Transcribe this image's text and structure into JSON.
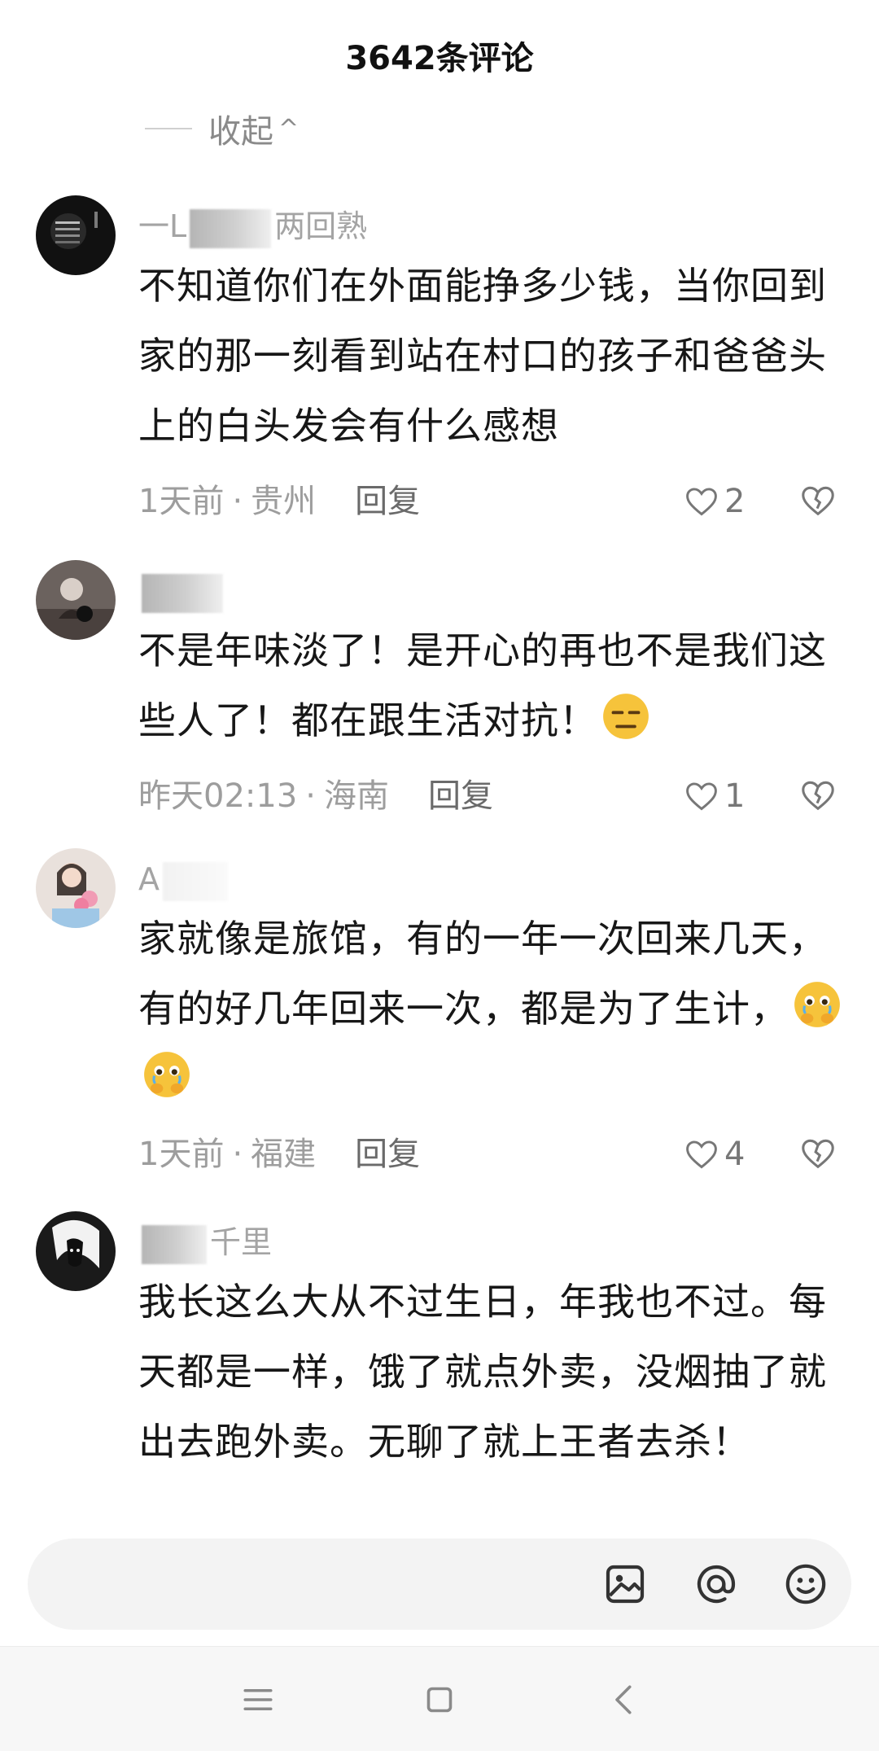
{
  "header": {
    "title": "3642条评论"
  },
  "collapse": {
    "label": "收起"
  },
  "comments": [
    {
      "username_prefix": "一L",
      "username_suffix": "两回熟",
      "text": "不知道你们在外面能挣多少钱，当你回到家的那一刻看到站在村口的孩子和爸爸头上的白头发会有什么感想",
      "time": "1天前",
      "location": "贵州",
      "reply": "回复",
      "likes": "2",
      "emojis": []
    },
    {
      "username_prefix": "",
      "username_suffix": "",
      "text": "不是年味淡了！是开心的再也不是我们这些人了！都在跟生活对抗！",
      "time": "昨天02:13",
      "location": "海南",
      "reply": "回复",
      "likes": "1",
      "emojis": [
        "unamused-face-emoji"
      ]
    },
    {
      "username_prefix": "A",
      "username_suffix": "",
      "text": "家就像是旅馆，有的一年一次回来几天，有的好几年回来一次，都是为了生计，",
      "time": "1天前",
      "location": "福建",
      "reply": "回复",
      "likes": "4",
      "emojis": [
        "holding-back-tears-emoji",
        "holding-back-tears-emoji"
      ]
    },
    {
      "username_prefix": "",
      "username_suffix": "千里",
      "text": "我长这么大从不过生日，年我也不过。每天都是一样，饿了就点外卖，没烟抽了就出去跑外卖。无聊了就上王者去杀！",
      "time": "",
      "location": "",
      "reply": "",
      "likes": "",
      "emojis": []
    }
  ],
  "meta_separator": "·",
  "input_bar": {
    "placeholder": "",
    "icons": [
      "image-icon",
      "at-icon",
      "emoji-icon"
    ]
  },
  "nav_bar": {
    "icons": [
      "menu-icon",
      "home-icon",
      "back-icon"
    ]
  },
  "colors": {
    "text": "#171717",
    "muted": "#9d9d9d",
    "input_bg": "#f3f3f3"
  }
}
